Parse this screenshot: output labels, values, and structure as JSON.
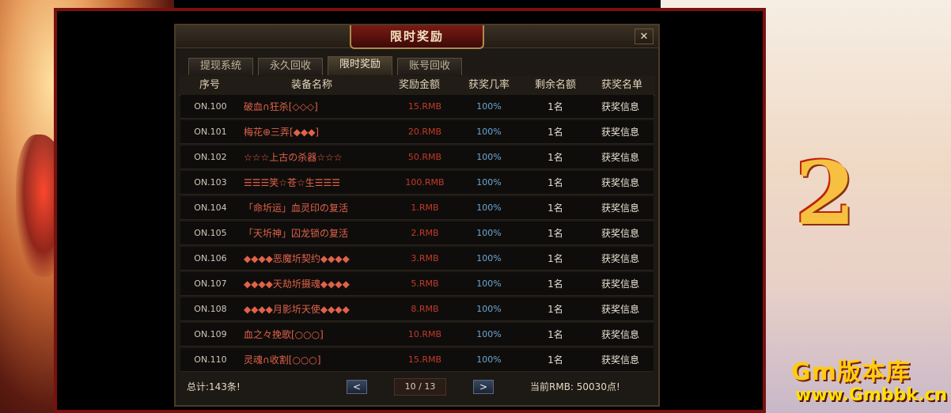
{
  "watermark": {
    "brand": "Gm版本库",
    "url": "www.Gmbbk.cn"
  },
  "dialog": {
    "title": "限时奖励",
    "close_label": "✕"
  },
  "tabs": [
    {
      "label": "提现系统"
    },
    {
      "label": "永久回收"
    },
    {
      "label": "限时奖励",
      "active": true
    },
    {
      "label": "账号回收"
    }
  ],
  "table": {
    "headers": [
      "序号",
      "装备名称",
      "奖励金额",
      "获奖几率",
      "剩余名额",
      "获奖名单"
    ],
    "rows": [
      {
        "no": "ON.100",
        "name": "破血∩狂杀[◇◇◇]",
        "amount": "15.RMB",
        "rate": "100%",
        "remaining": "1名",
        "info": "获奖信息"
      },
      {
        "no": "ON.101",
        "name": "梅花⊕三弄[◆◆◆]",
        "amount": "20.RMB",
        "rate": "100%",
        "remaining": "1名",
        "info": "获奖信息"
      },
      {
        "no": "ON.102",
        "name": "☆☆☆上古の杀器☆☆☆",
        "amount": "50.RMB",
        "rate": "100%",
        "remaining": "1名",
        "info": "获奖信息"
      },
      {
        "no": "ON.103",
        "name": "☰☰☰笑☆苍☆生☰☰☰",
        "amount": "100.RMB",
        "rate": "100%",
        "remaining": "1名",
        "info": "获奖信息"
      },
      {
        "no": "ON.104",
        "name": "「命圻运」血灵印の复活",
        "amount": "1.RMB",
        "rate": "100%",
        "remaining": "1名",
        "info": "获奖信息"
      },
      {
        "no": "ON.105",
        "name": "「天圻神」囚龙锁の复活",
        "amount": "2.RMB",
        "rate": "100%",
        "remaining": "1名",
        "info": "获奖信息"
      },
      {
        "no": "ON.106",
        "name": "◆◆◆◆恶魔圻契约◆◆◆◆",
        "amount": "3.RMB",
        "rate": "100%",
        "remaining": "1名",
        "info": "获奖信息"
      },
      {
        "no": "ON.107",
        "name": "◆◆◆◆天劫圻摄魂◆◆◆◆",
        "amount": "5.RMB",
        "rate": "100%",
        "remaining": "1名",
        "info": "获奖信息"
      },
      {
        "no": "ON.108",
        "name": "◆◆◆◆月影圻天使◆◆◆◆",
        "amount": "8.RMB",
        "rate": "100%",
        "remaining": "1名",
        "info": "获奖信息"
      },
      {
        "no": "ON.109",
        "name": "血之々挽歌[○○○]",
        "amount": "10.RMB",
        "rate": "100%",
        "remaining": "1名",
        "info": "获奖信息"
      },
      {
        "no": "ON.110",
        "name": "灵魂∩收割[○○○]",
        "amount": "15.RMB",
        "rate": "100%",
        "remaining": "1名",
        "info": "获奖信息"
      }
    ]
  },
  "footer": {
    "total": "总计:143条!",
    "prev_label": "<",
    "page": "10 / 13",
    "next_label": ">",
    "rmb": "当前RMB: 50030点!"
  },
  "colors": {
    "accent_red": "#c03a2a",
    "rate_blue": "#6aa8d8",
    "frame_red": "#7a1010"
  }
}
